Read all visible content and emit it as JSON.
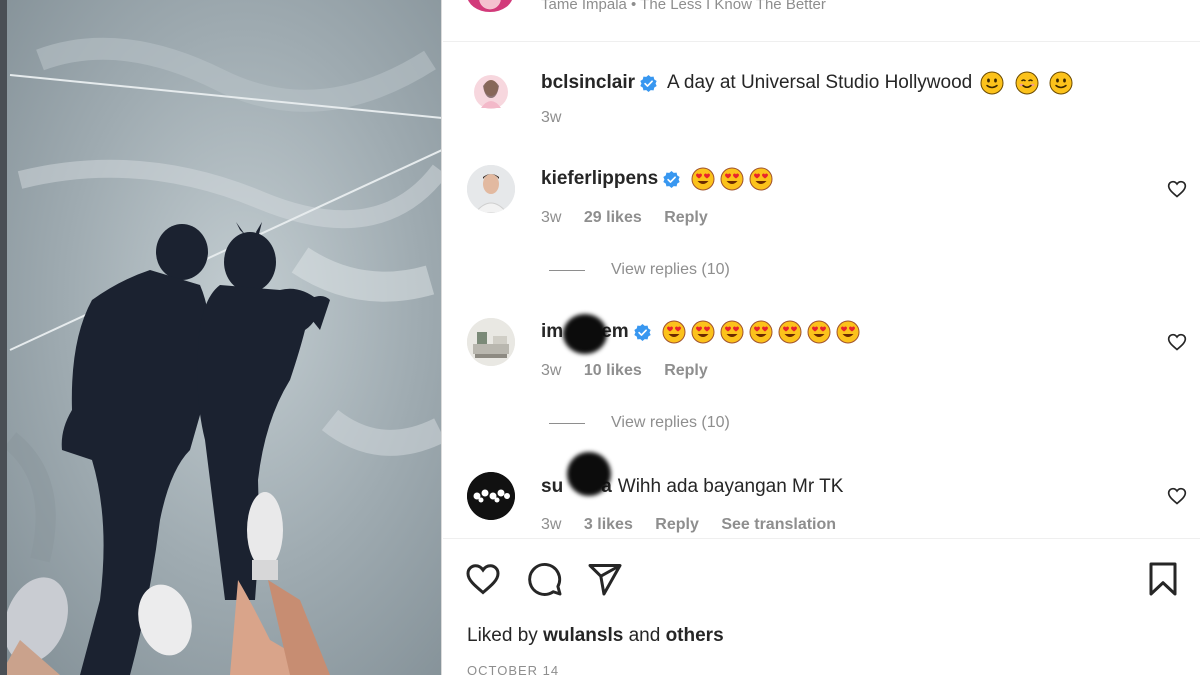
{
  "music": {
    "artist_track": "Tame Impala • The Less I Know The Better"
  },
  "caption": {
    "username": "bclsinclair",
    "text": "A day at Universal Studio Hollywood",
    "emojis": [
      "slightly-smiling-face",
      "smiling-face-with-smiling-eyes",
      "slightly-smiling-face"
    ],
    "time": "3w"
  },
  "comments": [
    {
      "username": "kieferlippens",
      "verified": true,
      "emojis": [
        "heart-eyes",
        "heart-eyes",
        "heart-eyes"
      ],
      "time": "3w",
      "likes": "29 likes",
      "reply": "Reply",
      "view_replies": "View replies (10)"
    },
    {
      "username_start": "im",
      "username_end": "em",
      "verified": true,
      "emojis": [
        "heart-eyes",
        "heart-eyes",
        "heart-eyes",
        "heart-eyes",
        "heart-eyes",
        "heart-eyes",
        "heart-eyes"
      ],
      "time": "3w",
      "likes": "10 likes",
      "reply": "Reply",
      "view_replies": "View replies (10)"
    },
    {
      "username_start": "su",
      "username_end": "a",
      "text": "Wihh ada bayangan Mr TK",
      "time": "3w",
      "likes": "3 likes",
      "reply": "Reply",
      "translate": "See translation"
    }
  ],
  "actions": {
    "icons": [
      "heart-icon",
      "comment-icon",
      "share-icon",
      "bookmark-icon"
    ]
  },
  "likes_line": {
    "prefix": "Liked by",
    "user": "wulansls",
    "middle": "and",
    "others": "others"
  },
  "date": "OCTOBER 14",
  "colors": {
    "verified_blue": "#3897f0",
    "muted_text": "#8e8e8e",
    "primary_text": "#262626"
  }
}
